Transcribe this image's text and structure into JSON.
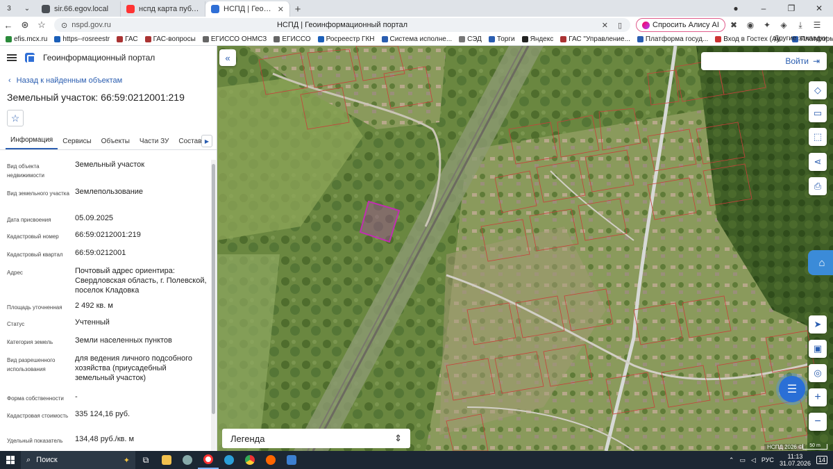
{
  "browser": {
    "tab_count": "3",
    "tabs": [
      {
        "title": "sir.66.egov.local",
        "color": "#4a4f55"
      },
      {
        "title": "нспд карта публичная кадастровая",
        "color": "#f33"
      },
      {
        "title": "НСПД | Геоинформационный портал",
        "color": "#2f6fd6"
      }
    ],
    "url": "nspd.gov.ru",
    "page_title": "НСПД | Геоинформационный портал",
    "alice_label": "Спросить Алису AI",
    "bookmarks": [
      {
        "label": "efis.mcx.ru",
        "color": "#2a8a3a"
      },
      {
        "label": "https--rosreestr",
        "color": "#1b5fb8"
      },
      {
        "label": "ГАС",
        "color": "#a33"
      },
      {
        "label": "ГАС-вопросы",
        "color": "#a33"
      },
      {
        "label": "ЕГИССО  ОНМСЗ",
        "color": "#666"
      },
      {
        "label": "ЕГИССО",
        "color": "#666"
      },
      {
        "label": "Росреестр ГКН",
        "color": "#1b5fb8"
      },
      {
        "label": "Система исполне...",
        "color": "#2a5db0"
      },
      {
        "label": "СЭД",
        "color": "#777"
      },
      {
        "label": "Торги",
        "color": "#2a5db0"
      },
      {
        "label": "Яндекс",
        "color": "#222"
      },
      {
        "label": "ГАС \"Управление...",
        "color": "#a33"
      },
      {
        "label": "Платформа госуд...",
        "color": "#2a5db0"
      },
      {
        "label": "Вход в Гостех (Ау...",
        "color": "#c33"
      },
      {
        "label": "Платформа госуд...",
        "color": "#2a5db0"
      },
      {
        "label": "Регио...",
        "color": "#2a8a3a"
      }
    ],
    "bookmarks_more": "Другие закладки"
  },
  "panel": {
    "app_title": "Геоинформационный портал",
    "back_label": "Назад к найденным объектам",
    "object_title": "Земельный участок: 66:59:0212001:219",
    "tabs": [
      "Информация",
      "Сервисы",
      "Объекты",
      "Части ЗУ",
      "Состав"
    ],
    "properties": [
      {
        "key": "Вид объекта недвижимости",
        "value": "Земельный участок"
      },
      {
        "key": "Вид земельного участка",
        "value": "Землепользование"
      },
      {
        "key": "Дата присвоения",
        "value": "05.09.2025"
      },
      {
        "key": "Кадастровый номер",
        "value": "66:59:0212001:219"
      },
      {
        "key": "Кадастровый квартал",
        "value": "66:59:0212001"
      },
      {
        "key": "Адрес",
        "value": "Почтовый адрес ориентира: Свердловская область, г. Полевской, поселок Кладовка"
      },
      {
        "key": "Площадь уточненная",
        "value": "2 492 кв. м"
      },
      {
        "key": "Статус",
        "value": "Учтенный"
      },
      {
        "key": "Категория земель",
        "value": "Земли населенных пунктов"
      },
      {
        "key": "Вид разрешенного использования",
        "value": "для ведения личного подсобного хозяйства (приусадебный земельный участок)"
      },
      {
        "key": "Форма собственности",
        "value": "-"
      },
      {
        "key": "Кадастровая стоимость",
        "value": "335 124,16 руб."
      },
      {
        "key": "Удельный показатель",
        "value": "134,48 руб./кв. м"
      }
    ]
  },
  "map": {
    "login_label": "Войти",
    "legend_label": "Легенда",
    "attribution": "НСПД 2026 ©",
    "scale": "50 m"
  },
  "taskbar": {
    "search_label": "Поиск",
    "lang": "РУС",
    "time": "11:13",
    "date": "31.07.2026",
    "notifications": "14"
  }
}
